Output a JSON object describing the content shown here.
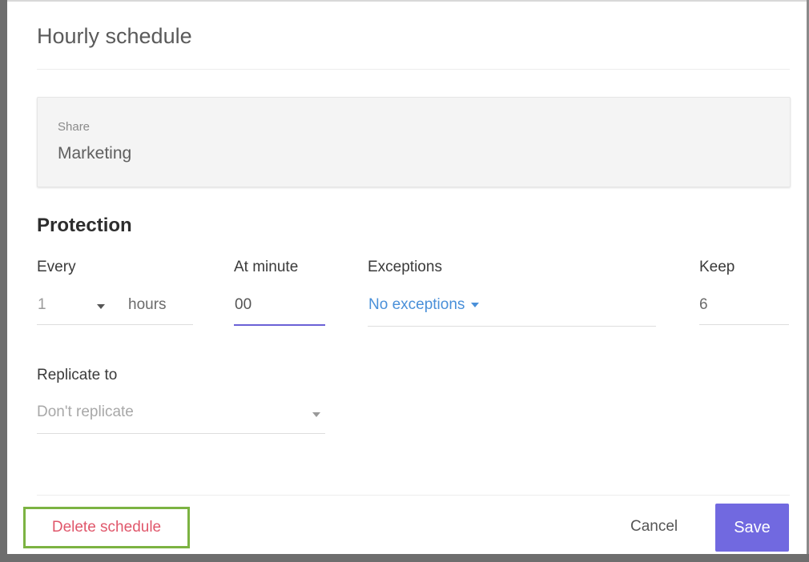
{
  "dialog": {
    "title": "Hourly schedule"
  },
  "share": {
    "label": "Share",
    "value": "Marketing"
  },
  "protection": {
    "title": "Protection",
    "every": {
      "label": "Every",
      "value": "1",
      "unit": "hours"
    },
    "at_minute": {
      "label": "At minute",
      "value": "00"
    },
    "exceptions": {
      "label": "Exceptions",
      "value": "No exceptions"
    },
    "keep": {
      "label": "Keep",
      "value": "6"
    }
  },
  "replicate": {
    "label": "Replicate to",
    "placeholder": "Don't replicate"
  },
  "footer": {
    "delete_label": "Delete schedule",
    "cancel_label": "Cancel",
    "save_label": "Save"
  },
  "colors": {
    "accent": "#7169e0",
    "link": "#4a90d9",
    "danger": "#e0576b",
    "highlight": "#7cb342"
  }
}
